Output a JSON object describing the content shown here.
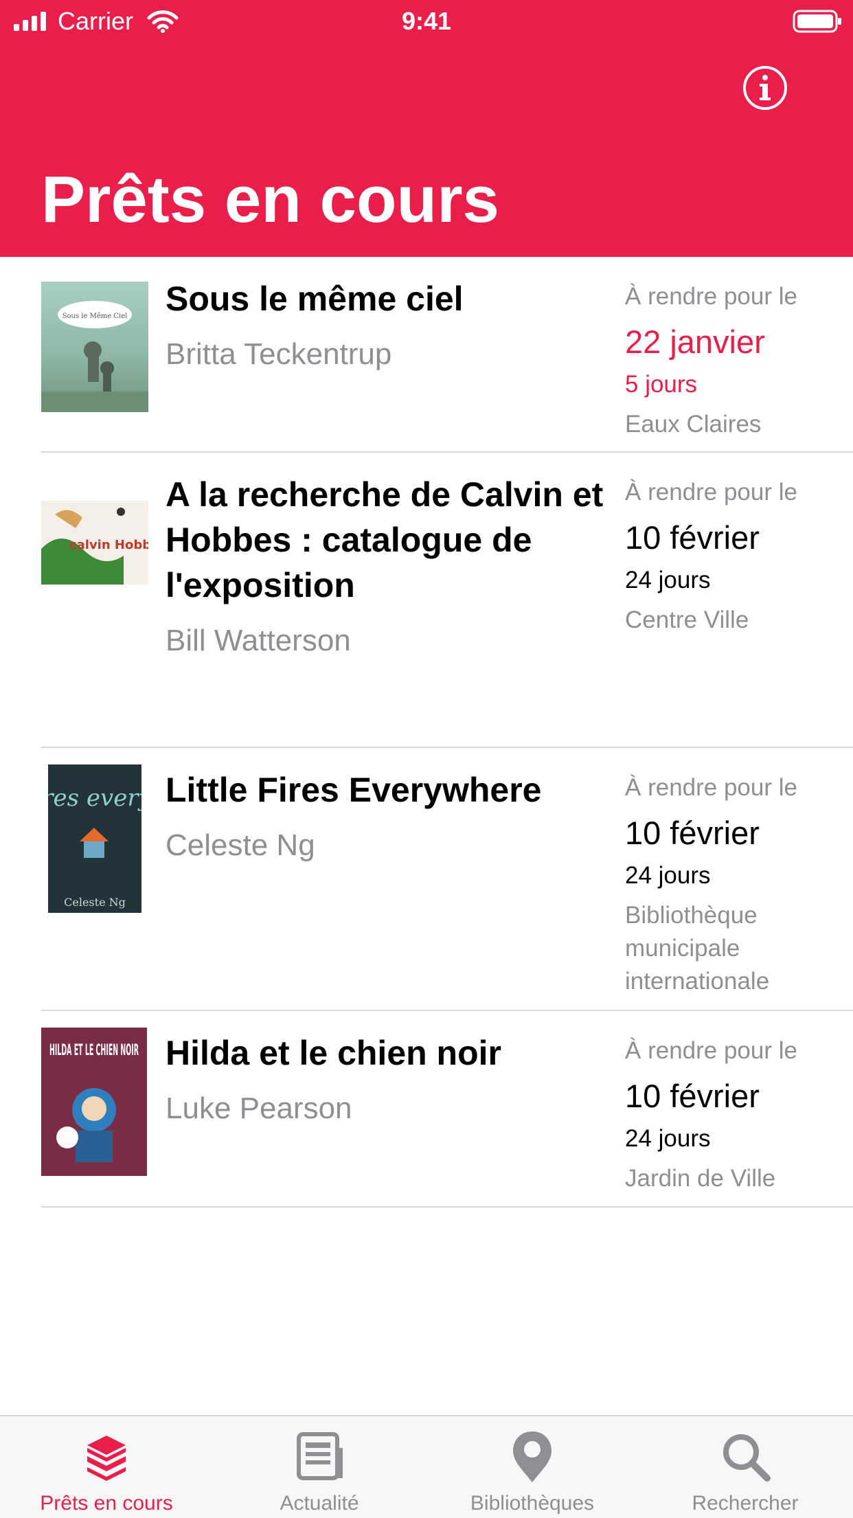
{
  "status_bar": {
    "carrier": "Carrier",
    "time": "9:41"
  },
  "header": {
    "title": "Prêts en cours",
    "info_icon": "info-circle-icon"
  },
  "colors": {
    "accent": "#e91e4a",
    "secondary_text": "#8e8e93",
    "divider": "#d9d9d9"
  },
  "loans": [
    {
      "title": "Sous le même ciel",
      "author": "Britta Teckentrup",
      "due_label": "À rendre pour le",
      "due_date": "22 janvier",
      "days_left": "5 jours",
      "library": "Eaux Claires",
      "urgent": true,
      "cover_text": "Sous le Même Ciel"
    },
    {
      "title": "A la recherche de Calvin et Hobbes : catalogue de l'exposition",
      "author": "Bill Watterson",
      "due_label": "À rendre pour le",
      "due_date": "10 février",
      "days_left": "24 jours",
      "library": "Centre Ville",
      "urgent": false,
      "cover_text": "calvin Hobbes"
    },
    {
      "title": "Little Fires Everywhere",
      "author": "Celeste Ng",
      "due_label": "À rendre pour le",
      "due_date": "10 février",
      "days_left": "24 jours",
      "library": "Bibliothèque municipale internationale",
      "urgent": false,
      "cover_text": "little fires everywhere",
      "cover_author": "Celeste Ng"
    },
    {
      "title": "Hilda et le chien noir",
      "author": "Luke Pearson",
      "due_label": "À rendre pour le",
      "due_date": "10 février",
      "days_left": "24 jours",
      "library": "Jardin de Ville",
      "urgent": false,
      "cover_text": "HILDA ET LE CHIEN NOIR"
    }
  ],
  "tabs": [
    {
      "label": "Prêts en cours",
      "icon": "books-stack-icon",
      "active": true
    },
    {
      "label": "Actualité",
      "icon": "newspaper-icon",
      "active": false
    },
    {
      "label": "Bibliothèques",
      "icon": "map-pin-icon",
      "active": false
    },
    {
      "label": "Rechercher",
      "icon": "search-icon",
      "active": false
    }
  ]
}
